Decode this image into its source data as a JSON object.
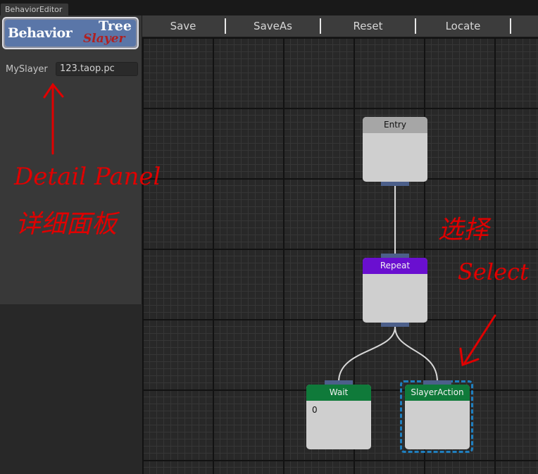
{
  "window": {
    "tab_title": "BehaviorEditor"
  },
  "logo": {
    "line1": "Behavior",
    "line2": "Tree",
    "line3": "Slayer"
  },
  "detail_panel": {
    "field_label": "MySlayer",
    "field_value": "123.taop.pc"
  },
  "toolbar": {
    "save": "Save",
    "save_as": "SaveAs",
    "reset": "Reset",
    "locate": "Locate"
  },
  "nodes": {
    "entry": {
      "title": "Entry",
      "color": "#a6a6a6"
    },
    "repeat": {
      "title": "Repeat",
      "color": "#6a0fd0"
    },
    "wait": {
      "title": "Wait",
      "value": "0",
      "color": "#0f7a3a"
    },
    "slayer_action": {
      "title": "SlayerAction",
      "color": "#0f7a3a",
      "selected": true
    }
  },
  "annotations": {
    "detail_en": "Detail Panel",
    "detail_cn": "详细面板",
    "select_en": "Select",
    "select_cn": "选择",
    "color": "#e00000"
  }
}
